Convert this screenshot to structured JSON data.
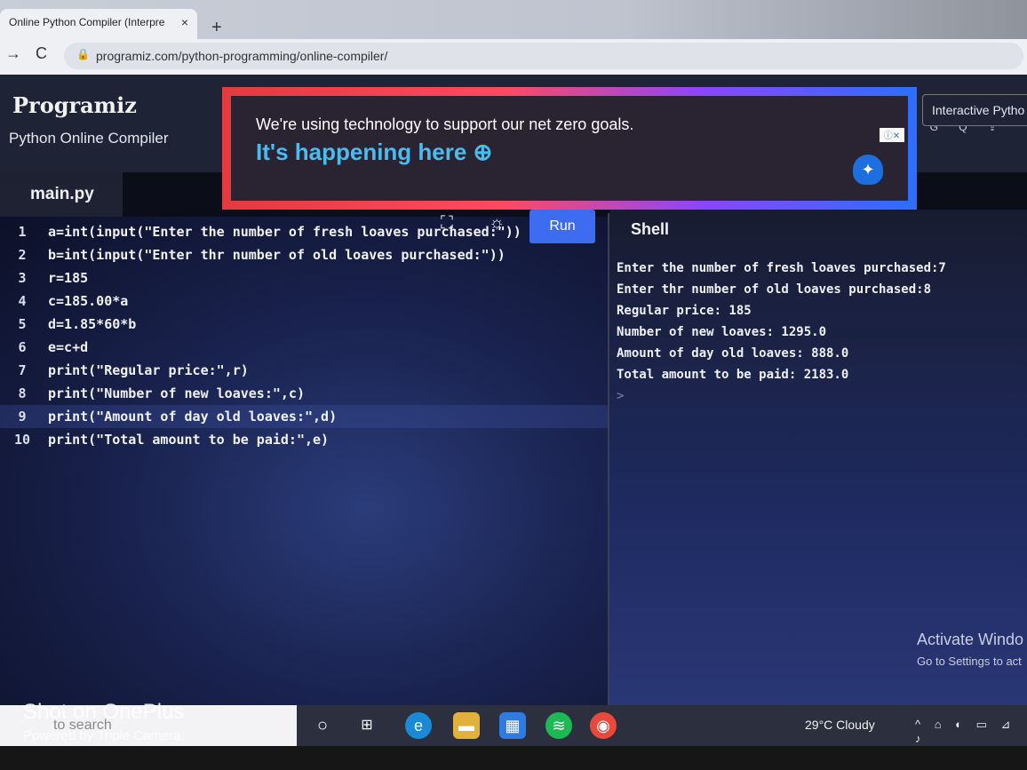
{
  "browser": {
    "tab_title": "Online Python Compiler (Interpre",
    "tab_close": "×",
    "new_tab": "+",
    "back": "→",
    "reload": "C",
    "url": "programiz.com/python-programming/online-compiler/"
  },
  "site": {
    "logo": "Programiz",
    "subtitle": "Python Online Compiler",
    "header_icons": "G  Q  ⇪",
    "interactive_label": "Interactive Pytho"
  },
  "ad": {
    "line1": "We're using technology to support our net zero goals.",
    "line2": "It's happening here ⊕",
    "badge": "ⓘ✕"
  },
  "editor": {
    "filename": "main.py",
    "run_label": "Run",
    "lines": [
      {
        "num": "1",
        "code": "a=int(input(\"Enter the number of fresh loaves purchased:\"))"
      },
      {
        "num": "2",
        "code": "b=int(input(\"Enter thr number of old loaves purchased:\"))"
      },
      {
        "num": "3",
        "code": "r=185"
      },
      {
        "num": "4",
        "code": "c=185.00*a"
      },
      {
        "num": "5",
        "code": "d=1.85*60*b"
      },
      {
        "num": "6",
        "code": "e=c+d"
      },
      {
        "num": "7",
        "code": "print(\"Regular price:\",r)"
      },
      {
        "num": "8",
        "code": "print(\"Number of new loaves:\",c)"
      },
      {
        "num": "9",
        "code": "print(\"Amount of day old loaves:\",d)"
      },
      {
        "num": "10",
        "code": "print(\"Total amount to be paid:\",e)"
      }
    ]
  },
  "shell": {
    "title": "Shell",
    "output": [
      "Enter the number of fresh loaves purchased:7",
      "Enter thr number of old loaves purchased:8",
      "Regular price: 185",
      "Number of new loaves: 1295.0",
      "Amount of day old loaves: 888.0",
      "Total amount to be paid: 2183.0"
    ],
    "prompt": ">"
  },
  "windows_notice": {
    "title": "Activate Windo",
    "subtitle": "Go to Settings to act"
  },
  "taskbar": {
    "search_placeholder": "to search",
    "weather": "29°C  Cloudy",
    "tray": "^ ⌂ ◐ ▭ ⊿ ♪"
  },
  "watermark": {
    "line1": "Shot on OnePlus",
    "line2": "Powered by Triple Camera"
  }
}
